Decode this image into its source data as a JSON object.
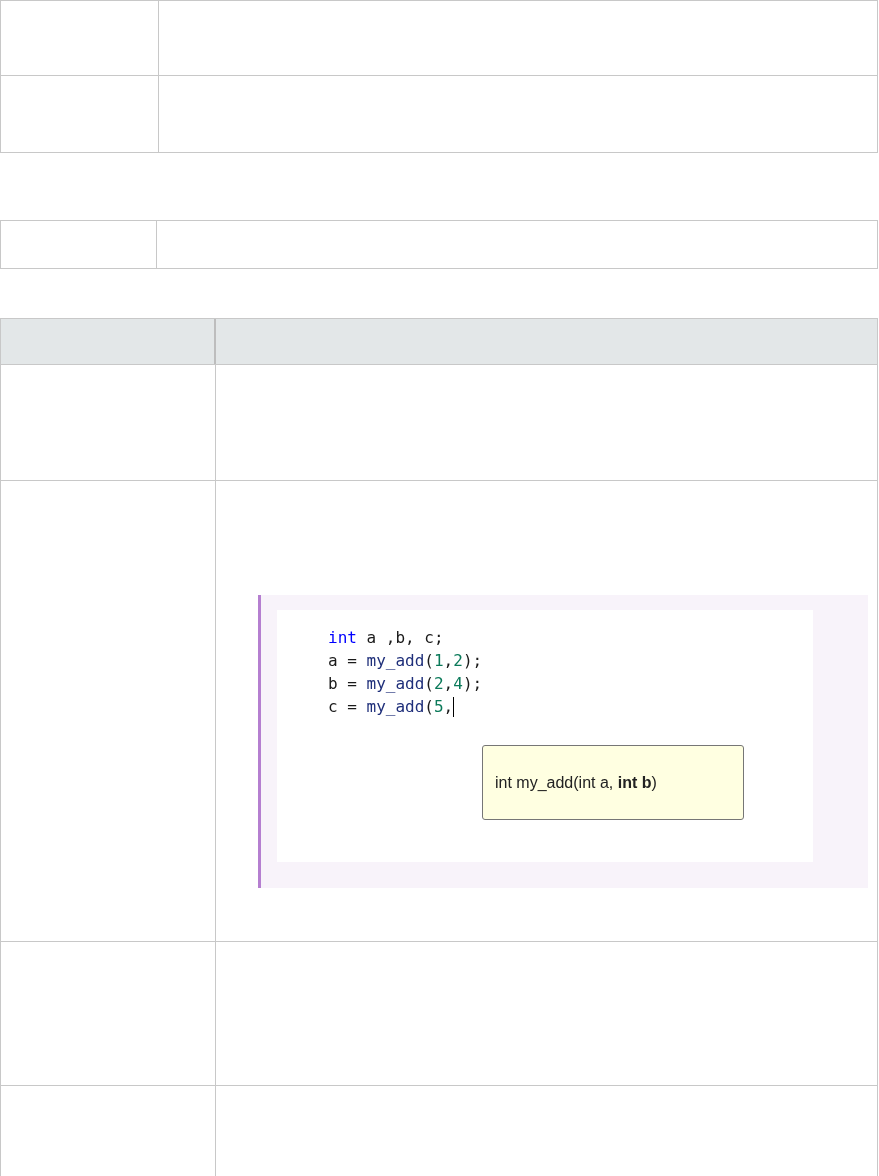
{
  "code_example": {
    "lines": [
      [
        {
          "text": "int",
          "kind": "keyword"
        },
        {
          "text": " a ,b, c;",
          "kind": "plain"
        }
      ],
      [
        {
          "text": "a = ",
          "kind": "plain"
        },
        {
          "text": "my_add",
          "kind": "function"
        },
        {
          "text": "(",
          "kind": "plain"
        },
        {
          "text": "1",
          "kind": "number"
        },
        {
          "text": ",",
          "kind": "plain"
        },
        {
          "text": "2",
          "kind": "number"
        },
        {
          "text": ");",
          "kind": "plain"
        }
      ],
      [
        {
          "text": "b = ",
          "kind": "plain"
        },
        {
          "text": "my_add",
          "kind": "function"
        },
        {
          "text": "(",
          "kind": "plain"
        },
        {
          "text": "2",
          "kind": "number"
        },
        {
          "text": ",",
          "kind": "plain"
        },
        {
          "text": "4",
          "kind": "number"
        },
        {
          "text": ");",
          "kind": "plain"
        }
      ],
      [
        {
          "text": "c = ",
          "kind": "plain"
        },
        {
          "text": "my_add",
          "kind": "function"
        },
        {
          "text": "(",
          "kind": "plain"
        },
        {
          "text": "5",
          "kind": "number"
        },
        {
          "text": ",",
          "kind": "plain"
        }
      ]
    ],
    "tooltip": "int my_add(int a, **int b**)"
  }
}
